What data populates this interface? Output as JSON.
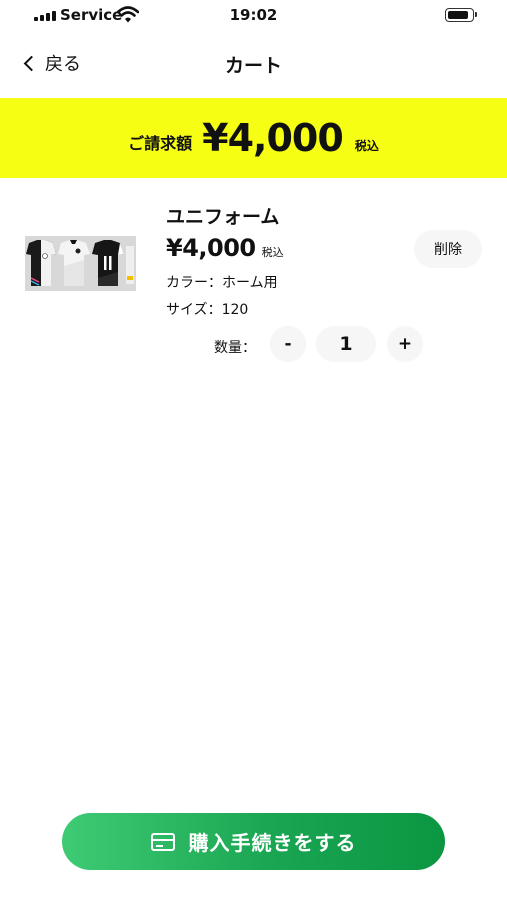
{
  "status_bar": {
    "carrier": "Service",
    "time": "19:02",
    "battery_level": 0.85
  },
  "nav": {
    "back_label": "戻る",
    "title": "カート"
  },
  "total": {
    "label": "ご請求額",
    "amount": "¥4,000",
    "tax_note": "税込",
    "background_color": "#f6ff13"
  },
  "cart_item": {
    "name": "ユニフォーム",
    "price": "¥4,000",
    "tax_note": "税込",
    "color": "カラー：ホーム用",
    "size": "サイズ：120",
    "delete_label": "削除",
    "quantity_label": "数量：",
    "minus_label": "-",
    "quantity": "1",
    "plus_label": "+"
  },
  "checkout": {
    "icon": "credit-card-icon",
    "label": "購入手続きをする",
    "color": "#1aa552"
  }
}
